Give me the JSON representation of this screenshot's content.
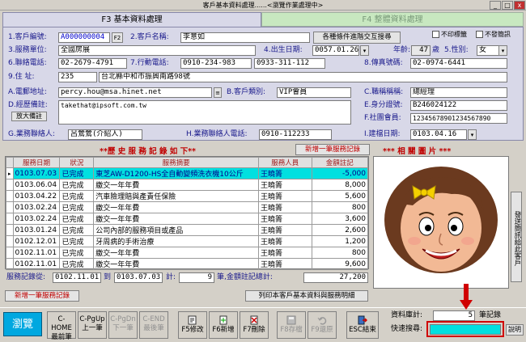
{
  "window": {
    "title": "客戶基本資料處理......<瀏覽作業處理中>",
    "min": "_",
    "max": "□",
    "close": "x"
  },
  "tabs": [
    {
      "label": "F3 基本資料處理"
    },
    {
      "label": "F4 整體資料處理"
    }
  ],
  "form": {
    "cust_no_label": "1.客戶編號:",
    "cust_no": "A000000004",
    "f2": "F2",
    "cust_name_label": "2.客戶名稱:",
    "cust_name": "李意如",
    "cond_query_btn": "各種條件進階交互搜尋",
    "no_print_label": "不印標籤",
    "no_send_label": "不發簡訊",
    "unit_label": "3.服務單位:",
    "unit": "全國房展",
    "birth_label": "4.出生日期:",
    "birth": "0057.01.26",
    "age_label": "年齡:",
    "age": "47",
    "age_unit": "歲",
    "gender_label": "5.性別:",
    "gender": "女",
    "phone_label": "6.聯絡電話:",
    "phone": "02-2679-4791",
    "mobile_label": "7.行動電話:",
    "mobile": "0910-234-983",
    "mobile2": "0933-311-112",
    "fax_label": "8.傳真號碼:",
    "fax": "02-0974-6441",
    "addr_label": "9.住   址:",
    "zip": "235",
    "addr": "台北縣中和市振興南路98號",
    "email_label": "A.電郵地址:",
    "email": "percy.hou@msa.hinet.net",
    "category_label": "B.客戶類別:",
    "category": "VIP會員",
    "title_label": "C.職稱稱稱:",
    "title": "總經理",
    "notes_label": "D.經歷備註:",
    "notes": "takethat@ipsoft.com.tw",
    "zoom_btn": "放大備註",
    "id_label": "E.身分證號:",
    "id": "B246024122",
    "social_label": "F.社團會員:",
    "social": "12345678901234567890",
    "contact_label": "G.業務聯絡人:",
    "contact": "呂鶯鶯(介紹人)",
    "contact_phone_label": "H.業務聯絡人電話:",
    "contact_phone": "0910-112233",
    "created_label": "I.建檔日期:",
    "created": "0103.04.16"
  },
  "history": {
    "title": "**歷 史 服 務 記 錄 如 下**",
    "add_btn": "新增一筆服務記錄",
    "columns": [
      "服務日期",
      "狀況",
      "服務摘要",
      "服務人員",
      "金額註記"
    ],
    "rows": [
      [
        "0103.07.03",
        "已完成",
        "東芝AW-D1200-HS全自動變頻洗衣機10公斤",
        "王曉箐",
        "-5,000"
      ],
      [
        "0103.06.04",
        "已完成",
        "繳交一年年費",
        "王曉箐",
        "8,000"
      ],
      [
        "0103.04.22",
        "已完成",
        "汽車險理賠與產責任保險",
        "王曉箐",
        "5,600"
      ],
      [
        "0103.02.24",
        "已完成",
        "繳交一年年費",
        "王曉箐",
        "800"
      ],
      [
        "0103.02.24",
        "已完成",
        "繳交一年年費",
        "王曉箐",
        "3,600"
      ],
      [
        "0103.01.24",
        "已完成",
        "公司內部的服務項目或產品",
        "王曉箐",
        "2,600"
      ],
      [
        "0102.12.01",
        "已完成",
        "牙周病的手術治療",
        "王曉箐",
        "1,200"
      ],
      [
        "0102.11.01",
        "已完成",
        "繳交一年年費",
        "王曉箐",
        "800"
      ],
      [
        "0102.11.01",
        "已完成",
        "繳交一年年費",
        "王曉箐",
        "9,600"
      ]
    ],
    "range_label": "服務記錄從:",
    "range_from": "0102.11.01",
    "to": "到",
    "range_to": "0103.07.03",
    "count_label": "計:",
    "count": "9",
    "sum_label": "筆,金額註記總計:",
    "sum": "27,200",
    "add_btn2": "新增一筆服務記錄",
    "print_btn": "列印本客戶基本資料與服務明細"
  },
  "photos": {
    "title": "*** 相 關 圖 片 ***",
    "side_btn": "發送簡訊給此客戶"
  },
  "toolbar": {
    "browse": "瀏覽",
    "buttons": [
      {
        "l1": "C-HOME",
        "l2": "最前筆"
      },
      {
        "l1": "C-PgUp",
        "l2": "上一筆"
      },
      {
        "l1": "C-PgDn",
        "l2": "下一筆"
      },
      {
        "l1": "C-END",
        "l2": "最後筆"
      },
      {
        "l1": "",
        "l2": "F5修改"
      },
      {
        "l1": "",
        "l2": "F6新增"
      },
      {
        "l1": "",
        "l2": "F7刪除"
      },
      {
        "l1": "",
        "l2": "F8存檔"
      },
      {
        "l1": "",
        "l2": "F9還原"
      },
      {
        "l1": "",
        "l2": "ESC結束"
      }
    ],
    "total_label": "資料庫計:",
    "total": "5",
    "total_unit": "筆記錄",
    "quick_label": "快速搜尋:",
    "quick_value": "",
    "explain": "說明"
  },
  "colors": {
    "accent": "#00e0e0",
    "highlight_red": "#d00000",
    "label_blue": "#1a1a8c"
  }
}
